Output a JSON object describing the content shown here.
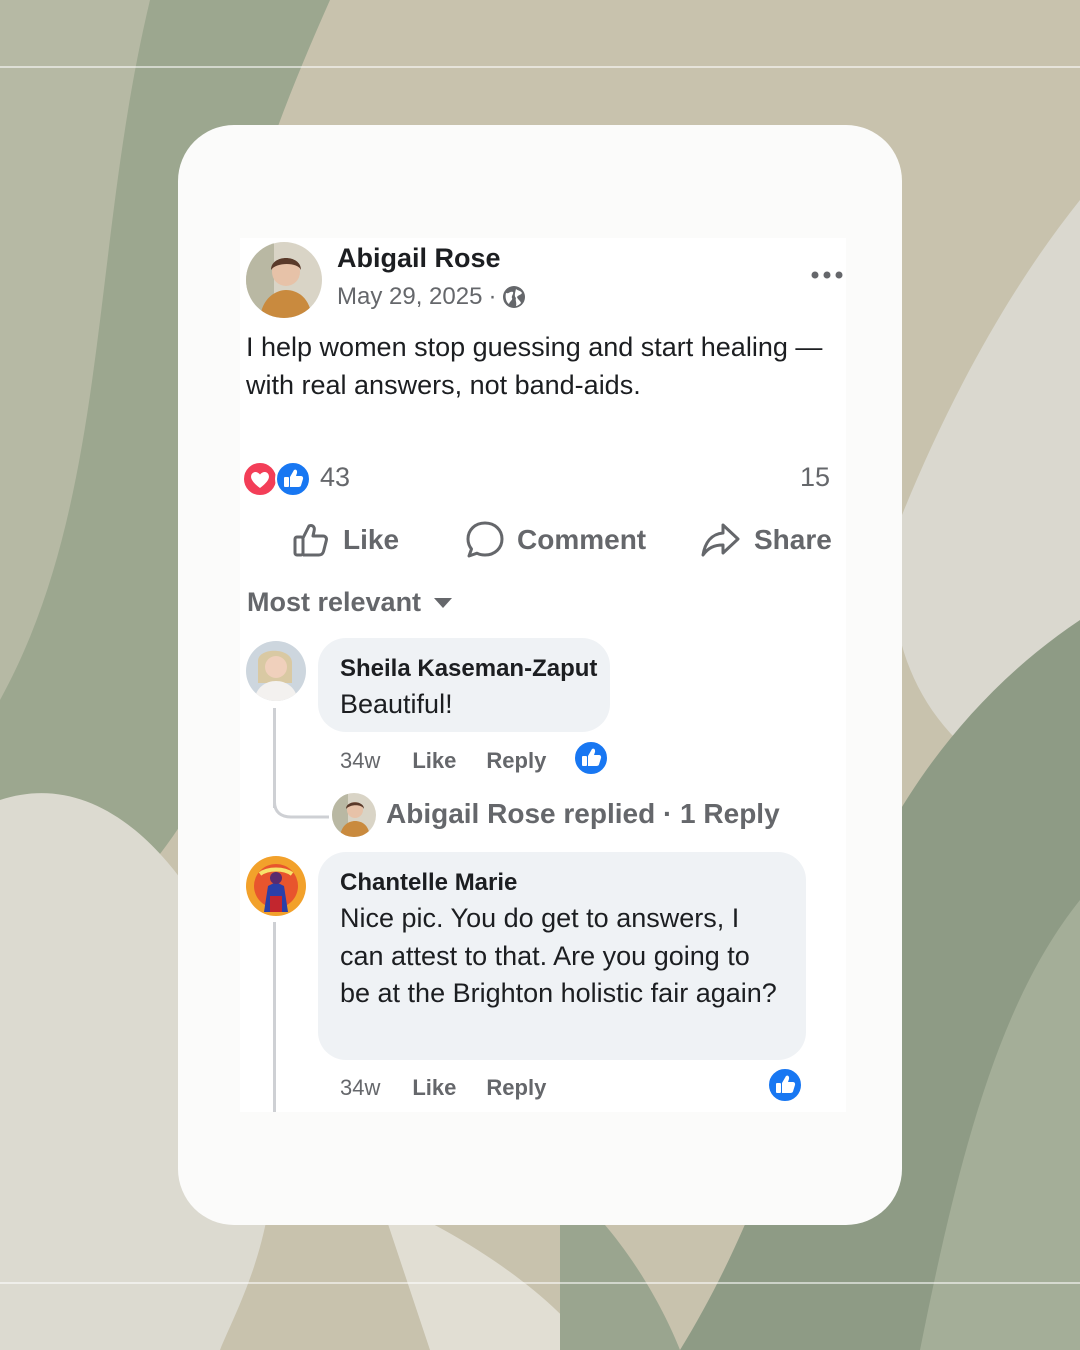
{
  "post": {
    "author": "Abigail Rose",
    "date": "May 29, 2025",
    "separator": "·",
    "visibility_icon": "globe-icon",
    "text": "I help women stop guessing and start healing — with real answers, not band-aids.",
    "reactions": {
      "icons": [
        "love-reaction-icon",
        "like-reaction-icon"
      ],
      "count": "43"
    },
    "comment_count": "15",
    "actions": {
      "like": "Like",
      "comment": "Comment",
      "share": "Share"
    }
  },
  "comments_sort": {
    "label": "Most relevant"
  },
  "comments": [
    {
      "author": "Sheila Kaseman-Zaput",
      "text": "Beautiful!",
      "time": "34w",
      "like_label": "Like",
      "reply_label": "Reply",
      "reaction_icon": "like-reaction-icon",
      "replies_summary": {
        "text": "Abigail Rose replied · 1 Reply"
      }
    },
    {
      "author": "Chantelle Marie",
      "text": "Nice pic. You do get to answers, I can attest to that. Are you going to be at the Brighton holistic fair again?",
      "time": "34w",
      "like_label": "Like",
      "reply_label": "Reply",
      "reaction_icon": "like-reaction-icon"
    }
  ],
  "colors": {
    "brand_blue": "#1877f2",
    "love_red": "#f33e58",
    "secondary_text": "#65676b",
    "bubble_bg": "#eff2f5",
    "card_bg": "#fbfbfa",
    "sage_green": "#8f9c86",
    "beige": "#c8c2ad"
  }
}
